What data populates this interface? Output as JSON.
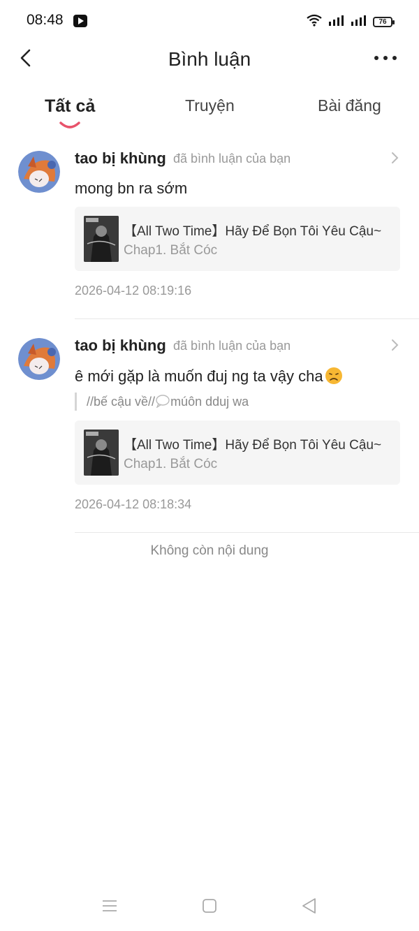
{
  "status_bar": {
    "time": "08:48",
    "battery": "76",
    "app_icon": "video-play-icon",
    "wifi_icon": "wifi-icon",
    "signal_icon": "signal-icon"
  },
  "header": {
    "title": "Bình luận",
    "back_icon": "back-arrow-icon",
    "more_icon": "more-dots-icon"
  },
  "tabs": [
    {
      "label": "Tất cả",
      "active": true
    },
    {
      "label": "Truyện",
      "active": false
    },
    {
      "label": "Bài đăng",
      "active": false
    }
  ],
  "colors": {
    "accent": "#e8536b",
    "card_bg": "#f5f5f5",
    "muted_text": "#999999"
  },
  "comments": [
    {
      "username": "tao bị khùng",
      "action": "đã bình luận của bạn",
      "text": "mong bn ra sớm",
      "story_title": "【All Two Time】Hãy Để Bọn Tôi Yêu Cậu~",
      "story_chapter": "Chap1. Bắt Cóc",
      "timestamp": "2026-04-12 08:19:16"
    },
    {
      "username": "tao bị khùng",
      "action": "đã bình luận của bạn",
      "text": "ê mới gặp là muốn đuj ng ta vậy cha",
      "emoji": "disappointed-face-icon",
      "quote_prefix": "//bế cậu về//",
      "quote_suffix": "múôn dduj wa",
      "story_title": "【All Two Time】Hãy Để Bọn Tôi Yêu Cậu~",
      "story_chapter": "Chap1. Bắt Cóc",
      "timestamp": "2026-04-12 08:18:34"
    }
  ],
  "end_text": "Không còn nội dung",
  "nav": {
    "menu_icon": "menu-icon",
    "home_icon": "home-square-icon",
    "back_icon": "back-triangle-icon"
  }
}
